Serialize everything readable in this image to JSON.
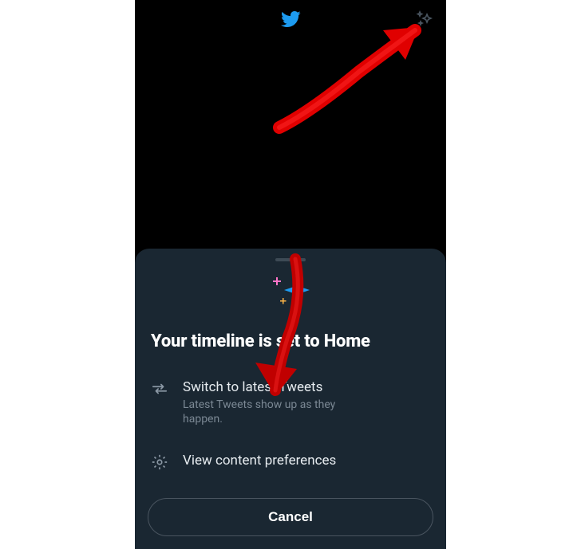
{
  "header": {
    "logo_name": "twitter-bird",
    "sparkle_button_name": "sparkles"
  },
  "sheet": {
    "title": "Your timeline is set to Home",
    "options": [
      {
        "icon": "swap",
        "primary": "Switch to latest Tweets",
        "secondary": "Latest Tweets show up as they happen."
      },
      {
        "icon": "gear",
        "primary": "View content preferences",
        "secondary": ""
      }
    ],
    "cancel_label": "Cancel"
  },
  "illustration_colors": {
    "plus1": "#ff74c8",
    "star": "#1d9bf0",
    "plus2": "#ffb547"
  }
}
